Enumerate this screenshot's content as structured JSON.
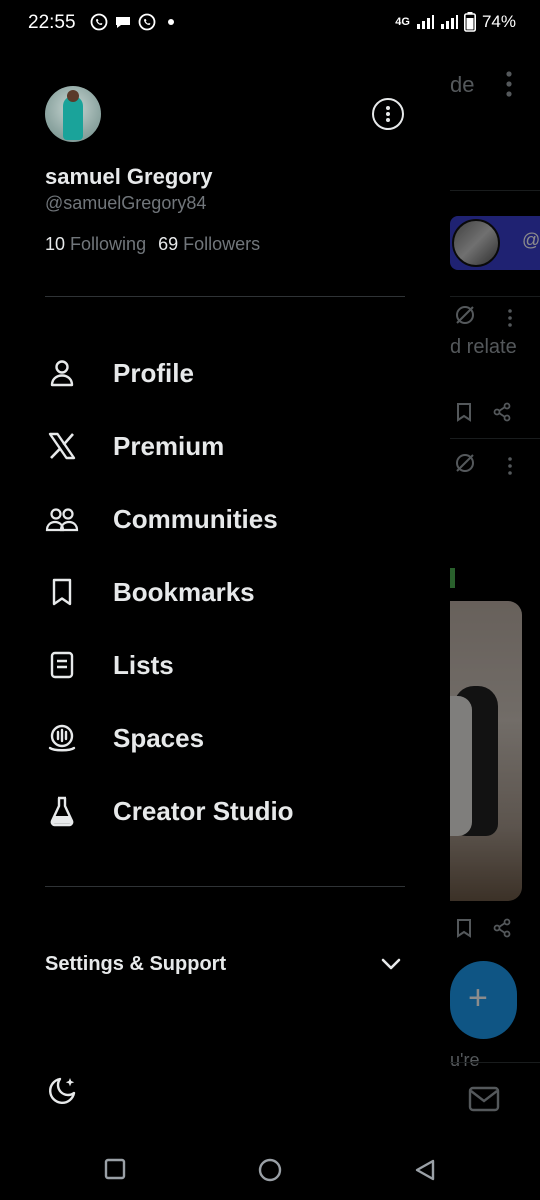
{
  "status_bar": {
    "time": "22:55",
    "network": "4G",
    "battery": "74%"
  },
  "drawer": {
    "user": {
      "display_name": "samuel Gregory",
      "handle": "@samuelGregory84",
      "following_count": "10",
      "following_label": "Following",
      "followers_count": "69",
      "followers_label": "Followers"
    },
    "menu": [
      {
        "label": "Profile",
        "icon": "person-icon"
      },
      {
        "label": "Premium",
        "icon": "x-logo-icon"
      },
      {
        "label": "Communities",
        "icon": "communities-icon"
      },
      {
        "label": "Bookmarks",
        "icon": "bookmark-icon"
      },
      {
        "label": "Lists",
        "icon": "list-icon"
      },
      {
        "label": "Spaces",
        "icon": "spaces-icon"
      },
      {
        "label": "Creator Studio",
        "icon": "creator-studio-icon"
      }
    ],
    "settings_label": "Settings & Support"
  },
  "background_feed": {
    "tab_fragment": "de",
    "banner_fragment": "@",
    "text_fragment_1": "d relate",
    "text_fragment_2": "u're"
  },
  "colors": {
    "background": "#000000",
    "primary_text": "#e7e9ea",
    "secondary_text": "#71767b",
    "divider": "#2f3336",
    "accent": "#1d9bf0"
  }
}
